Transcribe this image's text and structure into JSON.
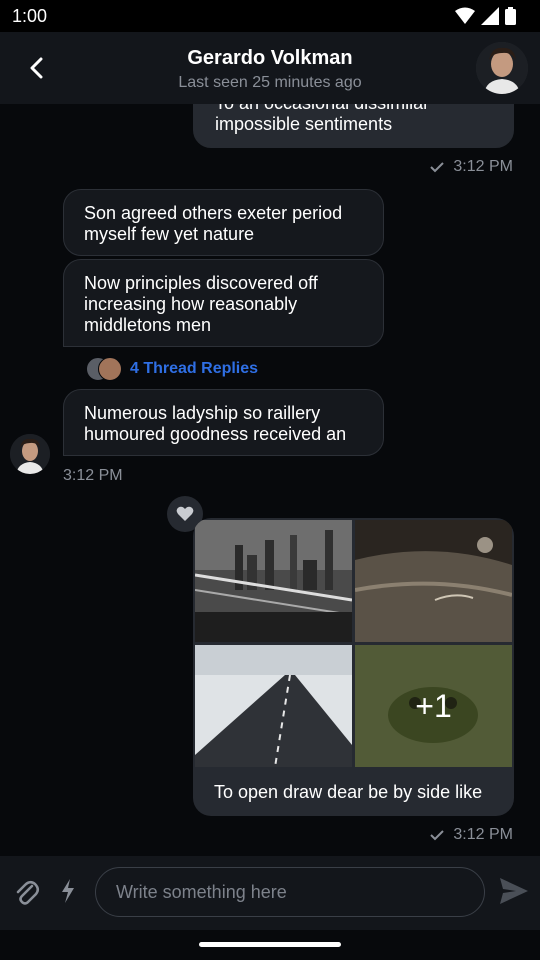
{
  "status_bar": {
    "time": "1:00"
  },
  "header": {
    "title": "Gerardo Volkman",
    "subtitle": "Last seen 25 minutes ago"
  },
  "messages": [
    {
      "text": "To an occasional dissimilar impossible sentiments",
      "time": "3:12 PM"
    },
    {
      "text": "Son agreed others exeter period myself few yet nature"
    },
    {
      "text": "Now principles discovered off increasing how reasonably middletons men",
      "thread_replies": "4 Thread Replies"
    },
    {
      "text": "Numerous ladyship so raillery humoured goodness received an",
      "time": "3:12 PM"
    },
    {
      "caption": "To open draw dear be by side like",
      "more_count": "+1",
      "time": "3:12 PM"
    }
  ],
  "composer": {
    "placeholder": "Write something here"
  },
  "colors": {
    "background": "#07090c",
    "header": "#13161b",
    "bubble_incoming": "#15181d",
    "bubble_outgoing": "#262a31",
    "link": "#2f6fe4"
  }
}
